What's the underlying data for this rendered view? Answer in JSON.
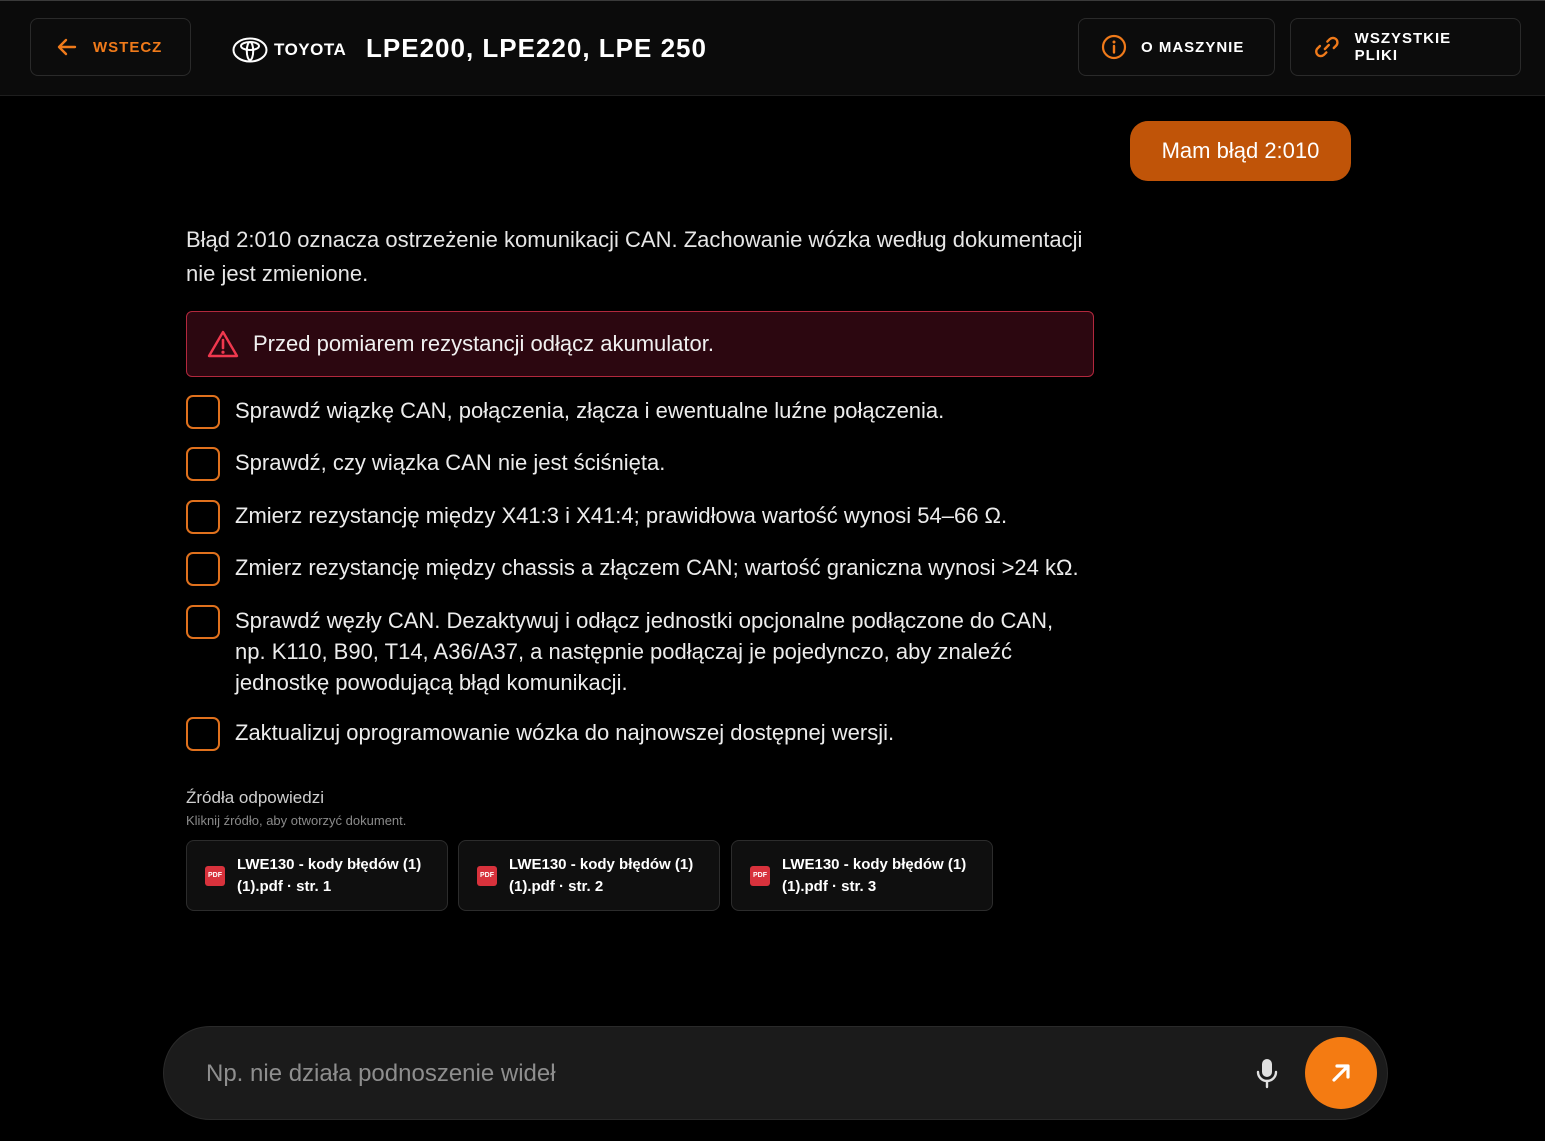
{
  "header": {
    "back_label": "WSTECZ",
    "brand_name": "TOYOTA",
    "model_title": "LPE200, LPE220, LPE 250",
    "about_label": "O MASZYNIE",
    "files_label": "WSZYSTKIE PLIKI"
  },
  "chat": {
    "user_message": "Mam błąd 2:010",
    "answer_intro": "Błąd 2:010 oznacza ostrzeżenie komunikacji CAN. Zachowanie wózka według dokumentacji nie jest zmienione.",
    "warning": "Przed pomiarem rezystancji odłącz akumulator.",
    "steps": [
      "Sprawdź wiązkę CAN, połączenia, złącza i ewentualne luźne połączenia.",
      "Sprawdź, czy wiązka CAN nie jest ściśnięta.",
      "Zmierz rezystancję między X41:3 i X41:4; prawidłowa wartość wynosi 54–66 Ω.",
      "Zmierz rezystancję między chassis a złączem CAN; wartość graniczna wynosi >24 kΩ.",
      "Sprawdź węzły CAN. Dezaktywuj i odłącz jednostki opcjonalne podłączone do CAN, np. K110, B90, T14, A36/A37, a następnie podłączaj je pojedynczo, aby znaleźć jednostkę powodującą błąd komunikacji.",
      "Zaktualizuj oprogramowanie wózka do najnowszej dostępnej wersji."
    ],
    "sources_title": "Źródła odpowiedzi",
    "sources_hint": "Kliknij źródło, aby otworzyć dokument.",
    "sources": [
      {
        "label": "LWE130 - kody błędów (1) (1).pdf · str. 1",
        "badge": "PDF"
      },
      {
        "label": "LWE130 - kody błędów (1) (1).pdf · str. 2",
        "badge": "PDF"
      },
      {
        "label": "LWE130 - kody błędów (1) (1).pdf · str. 3",
        "badge": "PDF"
      }
    ]
  },
  "composer": {
    "placeholder": "Np. nie działa podnoszenie wideł",
    "value": ""
  },
  "colors": {
    "accent": "#f47b12",
    "user_bubble": "#c05408",
    "warning_border": "#b2283d",
    "warning_bg": "#2c0710",
    "pdf_badge": "#d8323c"
  },
  "icons": {
    "back": "arrow-left-icon",
    "brand": "toyota-logo-icon",
    "about": "info-circle-icon",
    "files": "link-icon",
    "warning": "warning-triangle-icon",
    "source": "pdf-file-icon",
    "mic": "microphone-icon",
    "send": "arrow-up-right-icon"
  }
}
